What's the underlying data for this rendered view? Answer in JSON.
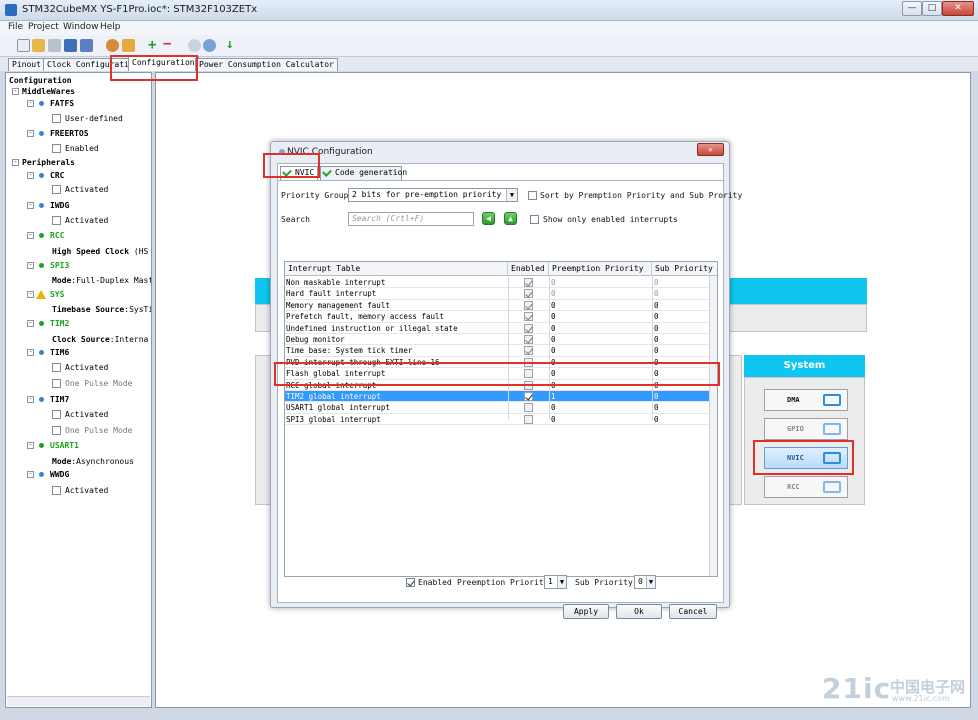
{
  "window": {
    "title": "STM32CubeMX YS-F1Pro.ioc*: STM32F103ZETx",
    "buttons": [
      "—",
      "□",
      "✕"
    ]
  },
  "menu": [
    "File",
    "Project",
    "Window",
    "Help"
  ],
  "main_tabs": [
    "Pinout",
    "Clock Configuration",
    "Configuration",
    "Power Consumption Calculator"
  ],
  "tree": {
    "root": "Configuration",
    "middlewares": "MiddleWares",
    "fatfs": "FATFS",
    "fatfs_opt": "User-defined",
    "freertos": "FREERTOS",
    "freertos_opt": "Enabled",
    "peripherals": "Peripherals",
    "crc": "CRC",
    "crc_opt": "Activated",
    "iwdg": "IWDG",
    "iwdg_opt": "Activated",
    "rcc": "RCC",
    "rcc_opt_bold": "High Speed Clock",
    "rcc_opt_rest": "(HS",
    "spi3": "SPI3",
    "spi3_opt_bold": "Mode",
    "spi3_opt_rest": ":Full-Duplex Master",
    "sys": "SYS",
    "sys_opt_bold": "Timebase Source",
    "sys_opt_rest": ":SysTi",
    "tim2": "TIM2",
    "tim2_opt_bold": "Clock Source",
    "tim2_opt_rest": ":Interna",
    "tim6": "TIM6",
    "tim6_opt1": "Activated",
    "tim6_opt2": "One Pulse Mode",
    "tim7": "TIM7",
    "tim7_opt1": "Activated",
    "tim7_opt2": "One Pulse Mode",
    "usart1": "USART1",
    "usart1_opt_bold": "Mode",
    "usart1_opt_rest": ":Asynchronous",
    "wwdg": "WWDG",
    "wwdg_opt": "Activated"
  },
  "system_panel": {
    "header": "System",
    "buttons": [
      "DMA",
      "GPIO",
      "NVIC",
      "RCC"
    ]
  },
  "dialog": {
    "title": "NVIC Configuration",
    "tabs": [
      "NVIC",
      "Code generation"
    ],
    "priority_group_label": "Priority Group",
    "priority_group_value": "2 bits for pre-emption priority ...",
    "sort_label": "Sort by Premption Priority and Sub Prority",
    "search_label": "Search",
    "search_placeholder": "Search (Crtl+F)",
    "show_enabled_label": "Show only enabled interrupts",
    "columns": [
      "Interrupt Table",
      "Enabled",
      "Preemption Priority",
      "Sub Priority"
    ],
    "rows": [
      {
        "name": "Non maskable interrupt",
        "enabled": true,
        "pre": "0",
        "sub": "0",
        "locked": true
      },
      {
        "name": "Hard fault interrupt",
        "enabled": true,
        "pre": "0",
        "sub": "0",
        "locked": true
      },
      {
        "name": "Memory management fault",
        "enabled": true,
        "pre": "0",
        "sub": "0",
        "locked": false
      },
      {
        "name": "Prefetch fault, memory access fault",
        "enabled": true,
        "pre": "0",
        "sub": "0",
        "locked": false
      },
      {
        "name": "Undefined instruction or illegal state",
        "enabled": true,
        "pre": "0",
        "sub": "0",
        "locked": false
      },
      {
        "name": "Debug monitor",
        "enabled": true,
        "pre": "0",
        "sub": "0",
        "locked": false
      },
      {
        "name": "Time base: System tick timer",
        "enabled": true,
        "pre": "0",
        "sub": "0",
        "locked": false
      },
      {
        "name": "PVD interrupt through EXTI line 16",
        "enabled": false,
        "pre": "0",
        "sub": "0",
        "locked": false
      },
      {
        "name": "Flash global interrupt",
        "enabled": false,
        "pre": "0",
        "sub": "0",
        "locked": false
      },
      {
        "name": "RCC global interrupt",
        "enabled": false,
        "pre": "0",
        "sub": "0",
        "locked": false
      },
      {
        "name": "TIM2 global interrupt",
        "enabled": true,
        "pre": "1",
        "sub": "0",
        "locked": false,
        "selected": true
      },
      {
        "name": "USART1 global interrupt",
        "enabled": false,
        "pre": "0",
        "sub": "0",
        "locked": false
      },
      {
        "name": "SPI3 global interrupt",
        "enabled": false,
        "pre": "0",
        "sub": "0",
        "locked": false
      }
    ],
    "bottom_enabled_label": "Enabled",
    "bottom_pre_label": "Preemption Priority",
    "bottom_pre_value": "1",
    "bottom_sub_label": "Sub Priority",
    "bottom_sub_value": "0",
    "apply": "Apply",
    "ok": "Ok",
    "cancel": "Cancel",
    "close": "✕"
  },
  "watermark": {
    "main": "21ic",
    "sub": "中国电子网",
    "url": "www.21ic.com"
  },
  "colors": {
    "accent_cyan": "#0ec6ef",
    "selection": "#3399ff",
    "annotation_red": "#e0302a",
    "tree_green": "#1aa31a"
  }
}
